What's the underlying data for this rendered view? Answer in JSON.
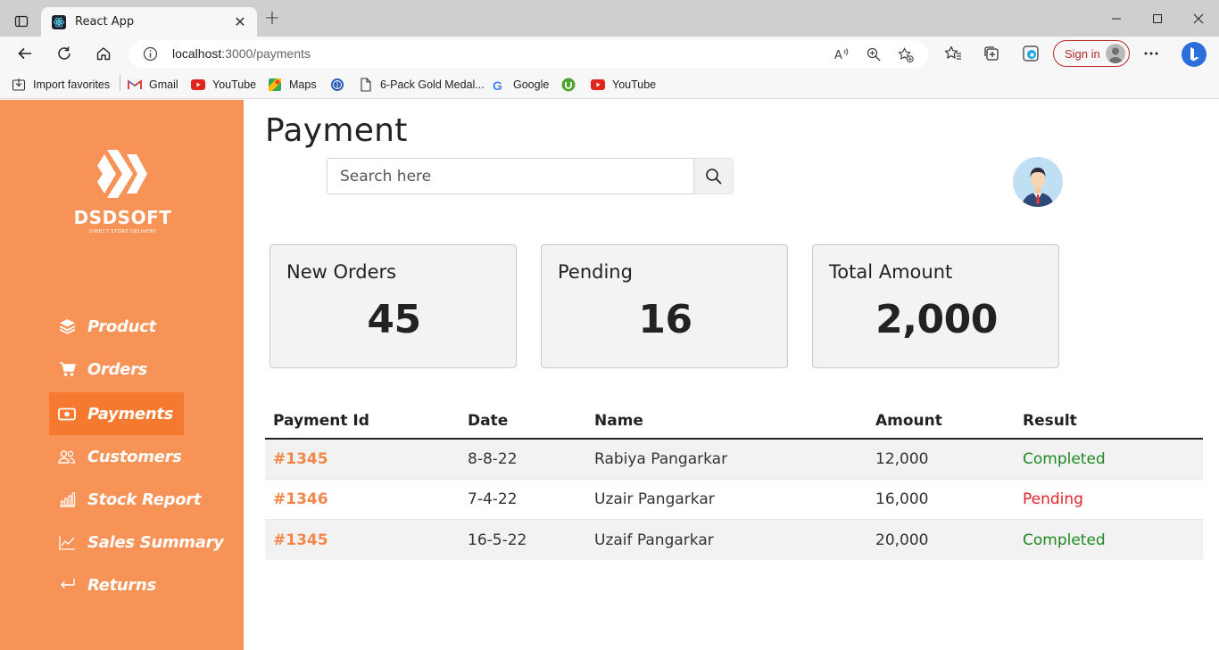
{
  "browser": {
    "tab_title": "React App",
    "url_host": "localhost",
    "url_rest": ":3000/payments",
    "sign_in": "Sign in",
    "favorites": [
      {
        "label": "Import favorites",
        "icon": "import-icon"
      },
      {
        "label": "Gmail",
        "icon": "gmail-icon"
      },
      {
        "label": "YouTube",
        "icon": "youtube-icon"
      },
      {
        "label": "Maps",
        "icon": "maps-icon"
      },
      {
        "label": "",
        "icon": "wikipedia-icon"
      },
      {
        "label": "6-Pack Gold Medal...",
        "icon": "page-icon"
      },
      {
        "label": "Google",
        "icon": "google-icon"
      },
      {
        "label": "",
        "icon": "utorrent-icon"
      },
      {
        "label": "YouTube",
        "icon": "youtube-icon"
      }
    ]
  },
  "brand": {
    "name": "DSDSOFT",
    "tagline": "DIRECT STORE DELIVERY",
    "accent": "#f79356",
    "active": "#f57a2f"
  },
  "sidebar": {
    "items": [
      {
        "label": "Product",
        "icon": "layers-icon"
      },
      {
        "label": "Orders",
        "icon": "cart-icon"
      },
      {
        "label": "Payments",
        "icon": "money-icon",
        "active": true
      },
      {
        "label": "Customers",
        "icon": "users-icon"
      },
      {
        "label": "Stock Report",
        "icon": "bar-chart-icon"
      },
      {
        "label": "Sales Summary",
        "icon": "line-chart-icon"
      },
      {
        "label": "Returns",
        "icon": "return-icon"
      }
    ]
  },
  "header": {
    "title": "Payment",
    "search_placeholder": "Search here"
  },
  "cards": [
    {
      "label": "New Orders",
      "value": "45"
    },
    {
      "label": "Pending",
      "value": "16"
    },
    {
      "label": "Total Amount",
      "value": "2,000"
    }
  ],
  "table": {
    "columns": [
      "Payment Id",
      "Date",
      "Name",
      "Amount",
      "Result"
    ],
    "rows": [
      {
        "id": "#1345",
        "date": "8-8-22",
        "name": "Rabiya Pangarkar",
        "amount": "12,000",
        "result": "Completed"
      },
      {
        "id": "#1346",
        "date": "7-4-22",
        "name": "Uzair Pangarkar",
        "amount": "16,000",
        "result": "Pending"
      },
      {
        "id": "#1345",
        "date": "16-5-22",
        "name": "Uzaif Pangarkar",
        "amount": "20,000",
        "result": "Completed"
      }
    ]
  }
}
